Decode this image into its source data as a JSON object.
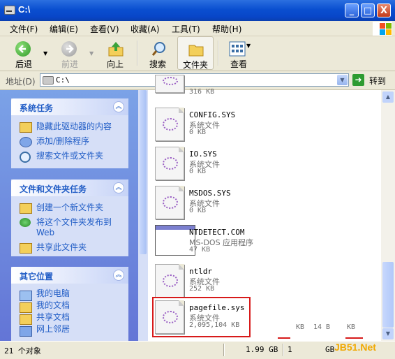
{
  "window": {
    "title": "C:\\",
    "minimize": "_",
    "maximize": "□",
    "close": "X"
  },
  "menu": [
    "文件(F)",
    "编辑(E)",
    "查看(V)",
    "收藏(A)",
    "工具(T)",
    "帮助(H)"
  ],
  "toolbar": {
    "back": "后退",
    "forward": "前进",
    "up": "向上",
    "search": "搜索",
    "folders": "文件夹",
    "views": "查看"
  },
  "address": {
    "label": "地址(D)",
    "value": "C:\\",
    "go": "转到"
  },
  "panels": [
    {
      "title": "系统任务",
      "items": [
        "隐藏此驱动器的内容",
        "添加/删除程序",
        "搜索文件或文件夹"
      ]
    },
    {
      "title": "文件和文件夹任务",
      "items": [
        "创建一个新文件夹",
        "将这个文件夹发布到Web",
        "共享此文件夹"
      ]
    },
    {
      "title": "其它位置",
      "items": [
        "我的电脑",
        "我的文档",
        "共享文档",
        "网上邻居"
      ]
    }
  ],
  "files": [
    {
      "name": "",
      "type": "",
      "size": "316 KB"
    },
    {
      "name": "CONFIG.SYS",
      "type": "系统文件",
      "size": "0 KB"
    },
    {
      "name": "IO.SYS",
      "type": "系统文件",
      "size": "0 KB"
    },
    {
      "name": "MSDOS.SYS",
      "type": "系统文件",
      "size": "0 KB"
    },
    {
      "name": "NTDETECT.COM",
      "type": "MS-DOS 应用程序",
      "size": "47 KB"
    },
    {
      "name": "ntldr",
      "type": "系统文件",
      "size": "252 KB"
    },
    {
      "name": "pagefile.sys",
      "type": "系统文件",
      "size": "2,095,104 KB"
    }
  ],
  "overlay": {
    "kb1": "KB",
    "mid": "14 B",
    "kb2": "KB"
  },
  "status": {
    "objects": "21 个对象",
    "size": "1.99 GB",
    "mid": "1",
    "gb": "GB"
  },
  "watermark": "JB51.Net"
}
